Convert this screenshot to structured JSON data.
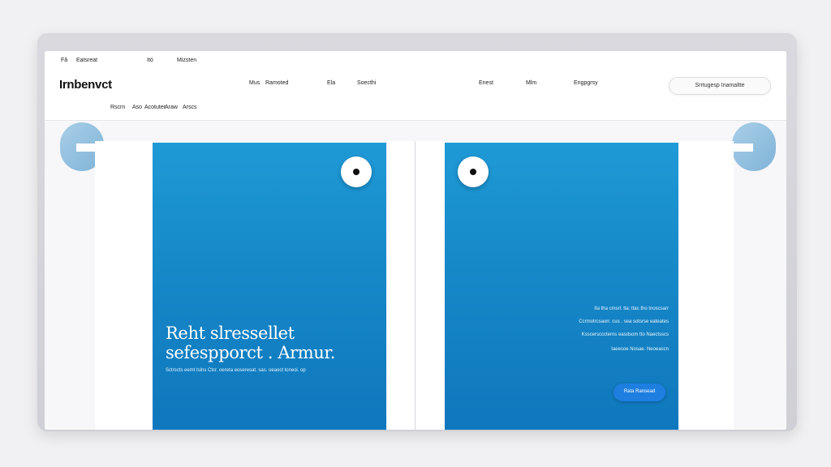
{
  "header": {
    "top_nav": [
      "Fâ",
      "Eatsreat",
      "Itó",
      "Mizsten"
    ],
    "brand": "Irnbenvct",
    "main_nav": [
      "Mus",
      "Ramoted",
      "Ela",
      "Soecthi",
      "Enest",
      "Mlm",
      "Engpgrsy"
    ],
    "sub_nav": [
      "Rscrn",
      "Aso",
      "Acotuter",
      "Araw",
      "Arscs"
    ],
    "search_label": "Srrtugesp Inamaltte"
  },
  "left_card": {
    "headline_line1": "Reht slressellet",
    "headline_line2": "sefespporct . Armur.",
    "subtext": "Sctrscts eemt tslns Ctcr. oereta eoseresat. sas. oeaoct tcneoi. op"
  },
  "right_card": {
    "copy_line1": "Ita tha cmsrl. tla; ttac tho tnoscsarr",
    "copy_line2": "Ccrmotrcsaorr. cus . sea sotsrse eateates",
    "copy_line3": "Ksscerscccterns easdsom tto Naectsscs",
    "copy_line4": "Iaeesoe Nosae. Neoeascn",
    "cta_label": "Rata Ransead"
  },
  "colors": {
    "card_blue": "#1688c8",
    "cta_blue": "#1e7fe0",
    "blob_blue": "#a9cfe7"
  }
}
